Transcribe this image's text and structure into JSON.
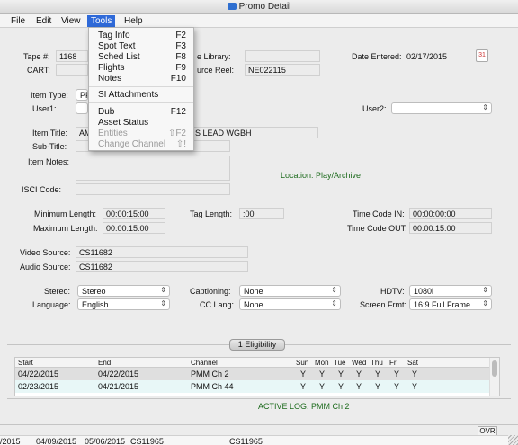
{
  "window": {
    "title": "Promo Detail"
  },
  "menubar": {
    "items": [
      "File",
      "Edit",
      "View",
      "Tools",
      "Help"
    ]
  },
  "tools_menu": {
    "items": [
      {
        "label": "Tag Info",
        "key": "F2",
        "disabled": false
      },
      {
        "label": "Spot Text",
        "key": "F3",
        "disabled": false
      },
      {
        "label": "Sched List",
        "key": "F8",
        "disabled": false
      },
      {
        "label": "Flights",
        "key": "F9",
        "disabled": false
      },
      {
        "label": "Notes",
        "key": "F10",
        "disabled": false
      },
      {
        "label": "SI Attachments",
        "key": "",
        "disabled": false
      },
      {
        "label": "Dub",
        "key": "F12",
        "disabled": false
      },
      {
        "label": "Asset Status",
        "key": "",
        "disabled": false
      },
      {
        "label": "Entities",
        "key": "⇧F2",
        "disabled": true
      },
      {
        "label": "Change Channel",
        "key": "⇧!",
        "disabled": true
      }
    ]
  },
  "form": {
    "tape_label": "Tape #:",
    "tape_value": "1168",
    "cart_label": "CART:",
    "library_label_partial": "e Library:",
    "library_value": "",
    "source_reel_label_partial": "urce Reel:",
    "source_reel_value": "NE022115",
    "date_entered_label": "Date Entered:",
    "date_entered_value": "02/17/2015",
    "item_type_label": "Item Type:",
    "item_type_value": "PF",
    "user1_label": "User1:",
    "user2_label": "User2:",
    "item_title_label": "Item Title:",
    "item_title_value_left": "AM",
    "item_title_value_right": "S LEAD WGBH",
    "subtitle_label": "Sub-Title:",
    "item_notes_label": "Item Notes:",
    "location_text": "Location: Play/Archive",
    "isci_label": "ISCI Code:",
    "min_length_label": "Minimum Length:",
    "min_length_value": "00:00:15:00",
    "max_length_label": "Maximum Length:",
    "max_length_value": "00:00:15:00",
    "tag_length_label": "Tag Length:",
    "tag_length_value": ":00",
    "tc_in_label": "Time Code IN:",
    "tc_in_value": "00:00:00:00",
    "tc_out_label": "Time Code OUT:",
    "tc_out_value": "00:00:15:00",
    "video_source_label": "Video Source:",
    "video_source_value": "CS11682",
    "audio_source_label": "Audio Source:",
    "audio_source_value": "CS11682",
    "stereo_label": "Stereo:",
    "stereo_value": "Stereo",
    "language_label": "Language:",
    "language_value": "English",
    "captioning_label": "Captioning:",
    "captioning_value": "None",
    "cclang_label": "CC Lang:",
    "cclang_value": "None",
    "hdtv_label": "HDTV:",
    "hdtv_value": "1080i",
    "screen_frmt_label": "Screen Frmt:",
    "screen_frmt_value": "16:9 Full Frame"
  },
  "eligibility": {
    "tab_label": "1 Eligibility",
    "headers": [
      "Start",
      "End",
      "Channel",
      "Sun",
      "Mon",
      "Tue",
      "Wed",
      "Thu",
      "Fri",
      "Sat"
    ],
    "rows": [
      [
        "04/22/2015",
        "04/22/2015",
        "PMM Ch 2",
        "Y",
        "Y",
        "Y",
        "Y",
        "Y",
        "Y",
        "Y"
      ],
      [
        "02/23/2015",
        "04/21/2015",
        "PMM Ch 44",
        "Y",
        "Y",
        "Y",
        "Y",
        "Y",
        "Y",
        "Y"
      ]
    ],
    "active_log": "ACTIVE LOG: PMM Ch 2"
  },
  "statusbar": {
    "ovr": "OVR",
    "bottom_values": [
      "/2015",
      "04/09/2015",
      "05/06/2015",
      "CS11965",
      "CS11965"
    ]
  },
  "colors": {
    "menu_highlight": "#2f6ad9",
    "selected_row": "#dfdfdf",
    "alt_row": "#e8f7f7",
    "location_text": "#1d6b1d"
  }
}
